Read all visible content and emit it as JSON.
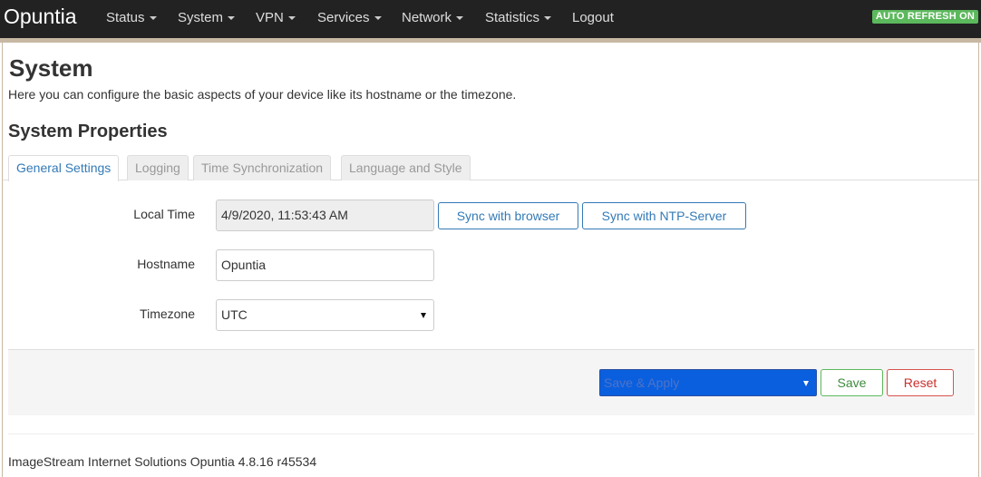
{
  "navbar": {
    "brand": "Opuntia",
    "items": [
      {
        "label": "Status",
        "dropdown": true
      },
      {
        "label": "System",
        "dropdown": true
      },
      {
        "label": "VPN",
        "dropdown": true
      },
      {
        "label": "Services",
        "dropdown": true
      },
      {
        "label": "Network",
        "dropdown": true
      },
      {
        "label": "Statistics",
        "dropdown": true
      },
      {
        "label": "Logout",
        "dropdown": false
      }
    ],
    "auto_refresh": "AUTO REFRESH ON",
    "auto_refresh_color": "#5cb85c"
  },
  "page": {
    "title": "System",
    "description": "Here you can configure the basic aspects of your device like its hostname or the timezone.",
    "section_title": "System Properties"
  },
  "tabs": [
    {
      "label": "General Settings",
      "active": true
    },
    {
      "label": "Logging",
      "active": false
    },
    {
      "label": "Time Synchronization",
      "active": false
    },
    {
      "label": "Language and Style",
      "active": false
    }
  ],
  "form": {
    "local_time": {
      "label": "Local Time",
      "value": "4/9/2020, 11:53:43 AM",
      "sync_browser": "Sync with browser",
      "sync_ntp": "Sync with NTP-Server"
    },
    "hostname": {
      "label": "Hostname",
      "value": "Opuntia"
    },
    "timezone": {
      "label": "Timezone",
      "value": "UTC"
    }
  },
  "actions": {
    "apply_select": "Save & Apply",
    "save": "Save",
    "reset": "Reset"
  },
  "footer": {
    "text": "ImageStream Internet Solutions Opuntia 4.8.16 r45534"
  },
  "colors": {
    "navbar_bg": "#222222",
    "link_blue": "#337ab7",
    "apply_select_bg": "#0a5fdf"
  }
}
